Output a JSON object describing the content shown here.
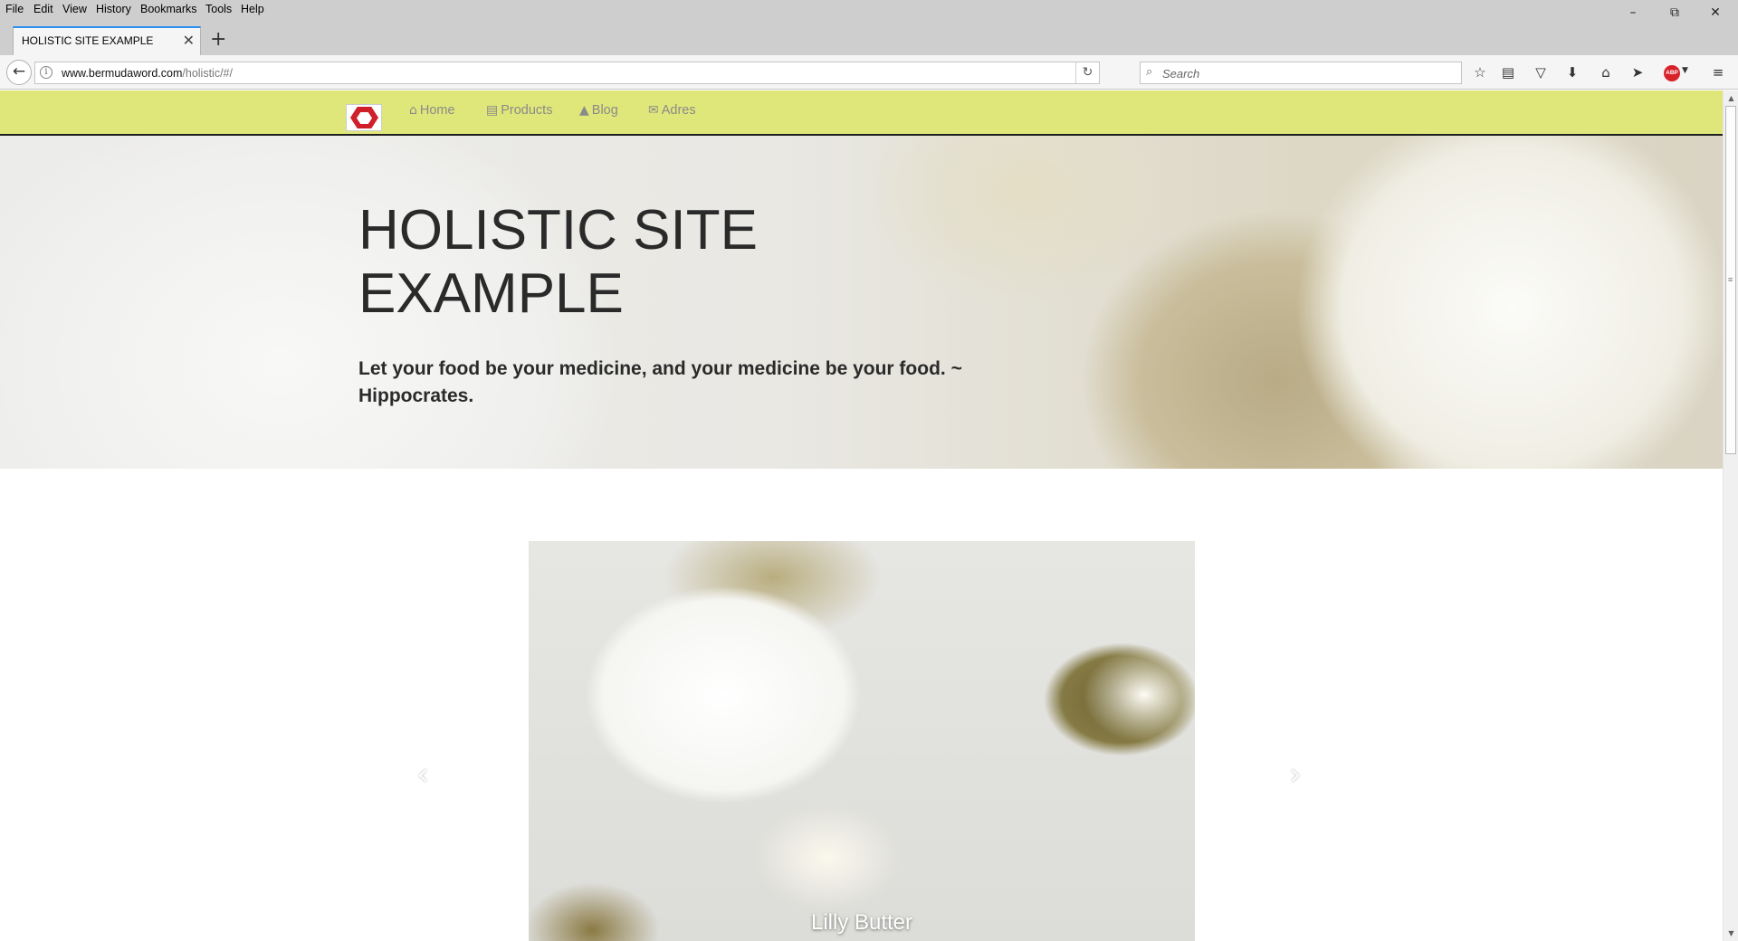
{
  "browser": {
    "menu": [
      {
        "label": "File"
      },
      {
        "label": "Edit"
      },
      {
        "label": "View"
      },
      {
        "label": "History"
      },
      {
        "label": "Bookmarks"
      },
      {
        "label": "Tools"
      },
      {
        "label": "Help"
      }
    ],
    "tab_title": "HOLISTIC SITE EXAMPLE",
    "url_domain": "www.bermudaword.com",
    "url_path": "/holistic/#/",
    "search_placeholder": "Search",
    "abp_label": "ABP"
  },
  "site": {
    "nav": [
      {
        "label": "Home",
        "icon": "home-icon"
      },
      {
        "label": "Products",
        "icon": "book-icon"
      },
      {
        "label": "Blog",
        "icon": "user-icon"
      },
      {
        "label": "Adres",
        "icon": "envelope-icon"
      }
    ],
    "hero": {
      "title": "HOLISTIC SITE EXAMPLE",
      "quote": "Let your food be your medicine, and your medicine be your food. ~ Hippocrates."
    },
    "carousel": {
      "caption": "Lilly Butter"
    }
  },
  "colors": {
    "nav_background": "#dfe77a",
    "logo_red": "#cf1f2b",
    "tab_accent": "#2b8ef1"
  }
}
